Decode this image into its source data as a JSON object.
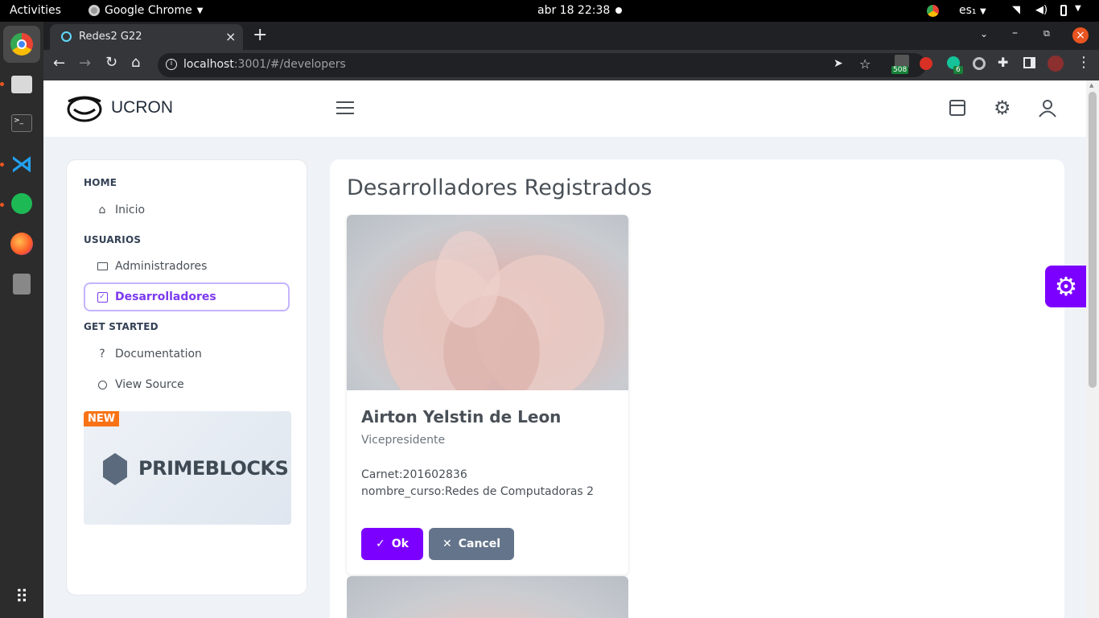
{
  "os": {
    "activities": "Activities",
    "app_name": "Google Chrome",
    "clock": "abr 18  22:38",
    "lang": "es₁"
  },
  "browser": {
    "tab_title": "Redes2 G22",
    "url_host": "localhost",
    "url_rest": ":3001/#/developers",
    "ext_badges": {
      "mail": "508",
      "grammar": "6"
    }
  },
  "app": {
    "brand": "UCRON"
  },
  "sidebar": {
    "sections": [
      {
        "title": "HOME",
        "items": [
          {
            "label": "Inicio",
            "icon": "home-icon"
          }
        ]
      },
      {
        "title": "USUARIOS",
        "items": [
          {
            "label": "Administradores",
            "icon": "id-card-icon"
          },
          {
            "label": "Desarrolladores",
            "icon": "check-square-icon",
            "active": true
          }
        ]
      },
      {
        "title": "GET STARTED",
        "items": [
          {
            "label": "Documentation",
            "icon": "question-icon"
          },
          {
            "label": "View Source",
            "icon": "search-icon"
          }
        ]
      }
    ],
    "promo": {
      "badge": "NEW",
      "title": "PRIMEBLOCKS"
    }
  },
  "main": {
    "title": "Desarrolladores Registrados",
    "card": {
      "name": "Airton Yelstin de Leon",
      "role": "Vicepresidente",
      "carnet": "Carnet:201602836",
      "course": "nombre_curso:Redes de Computadoras 2",
      "ok_label": "Ok",
      "cancel_label": "Cancel"
    }
  },
  "colors": {
    "accent": "#7c00ff",
    "secondary": "#64748b",
    "badge": "#f97316"
  }
}
